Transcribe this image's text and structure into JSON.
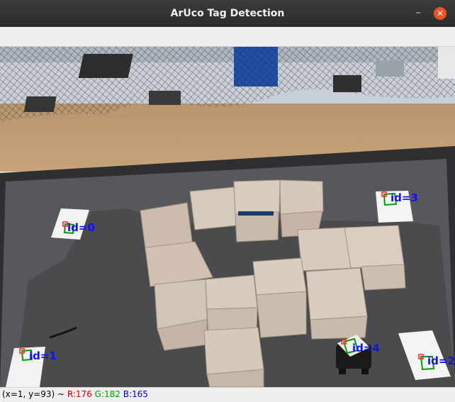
{
  "window": {
    "title": "ArUco Tag Detection",
    "minimize_glyph": "–",
    "close_glyph": "✕",
    "close_color": "#e95420"
  },
  "detections": [
    {
      "label": "id=0"
    },
    {
      "label": "id=1"
    },
    {
      "label": "id=2"
    },
    {
      "label": "id=3"
    },
    {
      "label": "id=4"
    }
  ],
  "colors": {
    "label": "#1010ff",
    "marker_outline": "#00a000",
    "corner": "#ff2020"
  },
  "status": {
    "coords": "(x=1, y=93) ~",
    "r": "R:176",
    "g": "G:182",
    "b": "B:165",
    "r_color": "#e00000",
    "g_color": "#00a000",
    "b_color": "#0000e0"
  }
}
